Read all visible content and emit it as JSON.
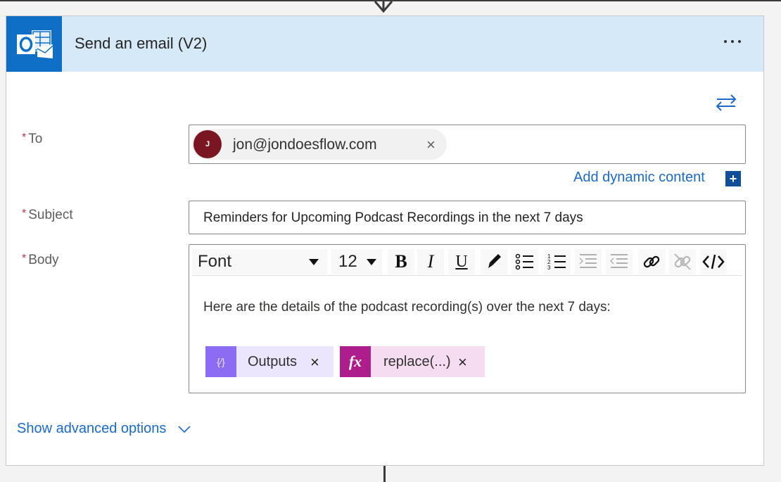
{
  "card": {
    "title": "Send an email (V2)",
    "icon": "outlook-icon",
    "more_icon": "more-options-icon",
    "swap_icon": "switch-mode-icon"
  },
  "fields": {
    "to": {
      "label": "To",
      "required_marker": "*",
      "recipient": {
        "initial": "J",
        "email": "jon@jondoesflow.com",
        "remove_glyph": "×"
      }
    },
    "dynamic_content": {
      "label": "Add dynamic content",
      "plus_glyph": "+"
    },
    "subject": {
      "label": "Subject",
      "required_marker": "*",
      "value": "Reminders for Upcoming Podcast Recordings in the next 7 days"
    },
    "body": {
      "label": "Body",
      "required_marker": "*",
      "toolbar": {
        "font": "Font",
        "size": "12",
        "bold": "B",
        "italic": "I",
        "underline": "U"
      },
      "text": "Here are the details of the podcast recording(s) over the next 7 days:",
      "tokens": [
        {
          "icon_glyph": "{⁄}",
          "label": "Outputs",
          "remove_glyph": "×"
        },
        {
          "icon_glyph": "fx",
          "label": "replace(...)",
          "remove_glyph": "×"
        }
      ]
    }
  },
  "advanced": {
    "label": "Show advanced options"
  },
  "colors": {
    "header_bg": "#d6e9f8",
    "outlook_blue": "#0f6fc6",
    "link_blue": "#1b6ac9",
    "required_red": "#c4314b",
    "avatar_bg": "#7a1621",
    "outputs_token": "#8c6cf3",
    "expression_token": "#ad1d8b"
  }
}
